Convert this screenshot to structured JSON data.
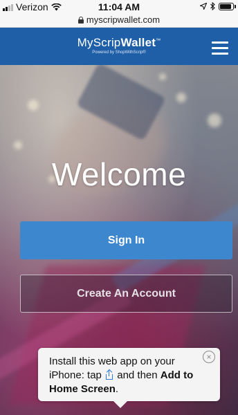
{
  "status_bar": {
    "carrier": "Verizon",
    "time": "11:04 AM",
    "url": "myscripwallet.com",
    "icons": [
      "signal-icon",
      "wifi-icon",
      "location-arrow-icon",
      "bluetooth-icon",
      "battery-icon"
    ],
    "battery_level": 0.9
  },
  "header": {
    "logo_light": "MyScrip",
    "logo_bold": "Wallet",
    "logo_tm": "™",
    "logo_tagline": "Powered by ShopWithScrip®",
    "menu_icon": "hamburger-menu-icon",
    "brand_color": "#1f5fa7"
  },
  "hero": {
    "title": "Welcome",
    "sign_in_label": "Sign In",
    "create_account_label": "Create An Account",
    "sign_in_color": "#3d87cf"
  },
  "install_popup": {
    "text_before_icon": "Install this web app on your iPhone: tap ",
    "text_after_icon": " and then ",
    "bold_text": "Add to Home Screen",
    "text_end": ".",
    "close_symbol": "×",
    "share_icon": "share-icon"
  }
}
